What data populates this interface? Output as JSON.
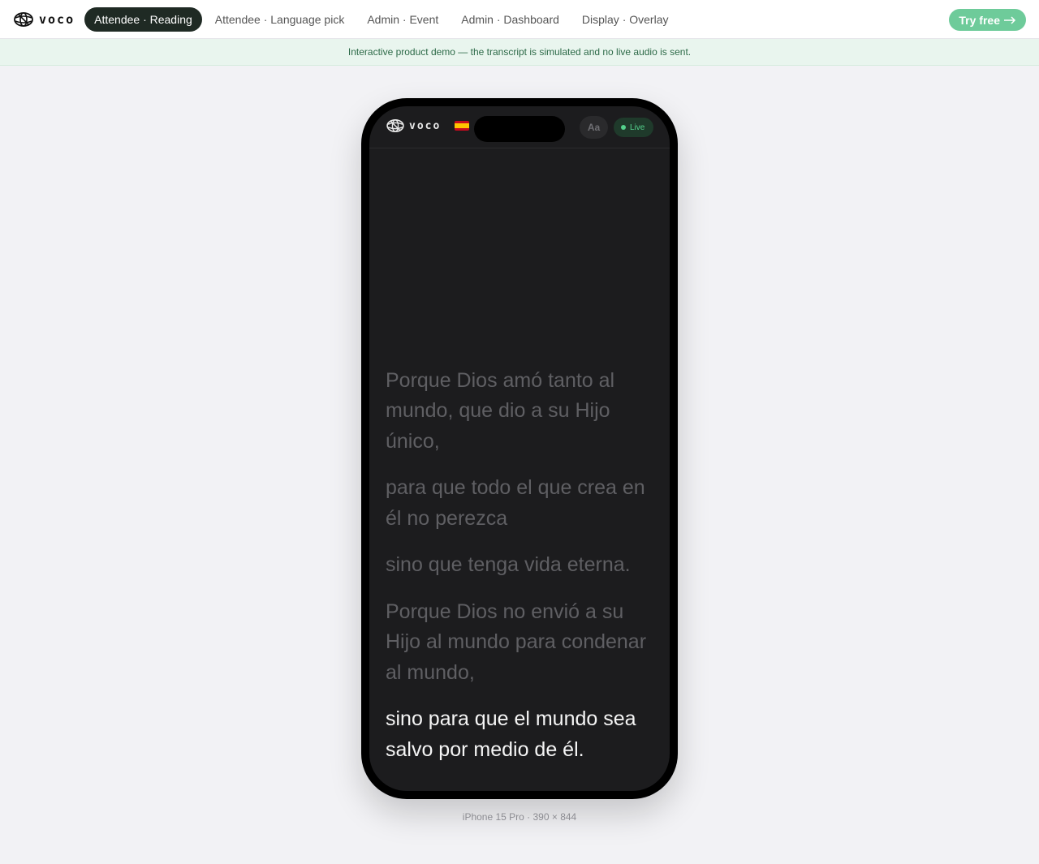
{
  "nav": {
    "brand": "voco",
    "tabs": [
      {
        "label": "Attendee · Reading",
        "active": true
      },
      {
        "label": "Attendee · Language pick",
        "active": false
      },
      {
        "label": "Admin · Event",
        "active": false
      },
      {
        "label": "Admin · Dashboard",
        "active": false
      },
      {
        "label": "Display · Overlay",
        "active": false
      }
    ],
    "cta": "Try free",
    "cta_icon": "arrow-right-icon"
  },
  "banner": "Interactive product demo — the transcript is simulated and no live audio is sent.",
  "app": {
    "brand": "voco",
    "language_flag": "spain-flag-icon",
    "font_size_button": "Aa",
    "live_label": "Live",
    "colors": {
      "live": "#54d18c",
      "accent": "#6ecb9a",
      "active_tab": "#1f2a24"
    }
  },
  "transcript": [
    {
      "text": "Porque Dios amó tanto al mundo, que dio a su Hijo único,",
      "current": false
    },
    {
      "text": "para que todo el que crea en él no perezca",
      "current": false
    },
    {
      "text": "sino que tenga vida eterna.",
      "current": false
    },
    {
      "text": "Porque Dios no envió a su Hijo al mundo para condenar al mundo,",
      "current": false
    },
    {
      "text": "sino para que el mundo sea salvo por medio de él.",
      "current": true
    }
  ],
  "device_caption": "iPhone 15 Pro · 390 × 844"
}
